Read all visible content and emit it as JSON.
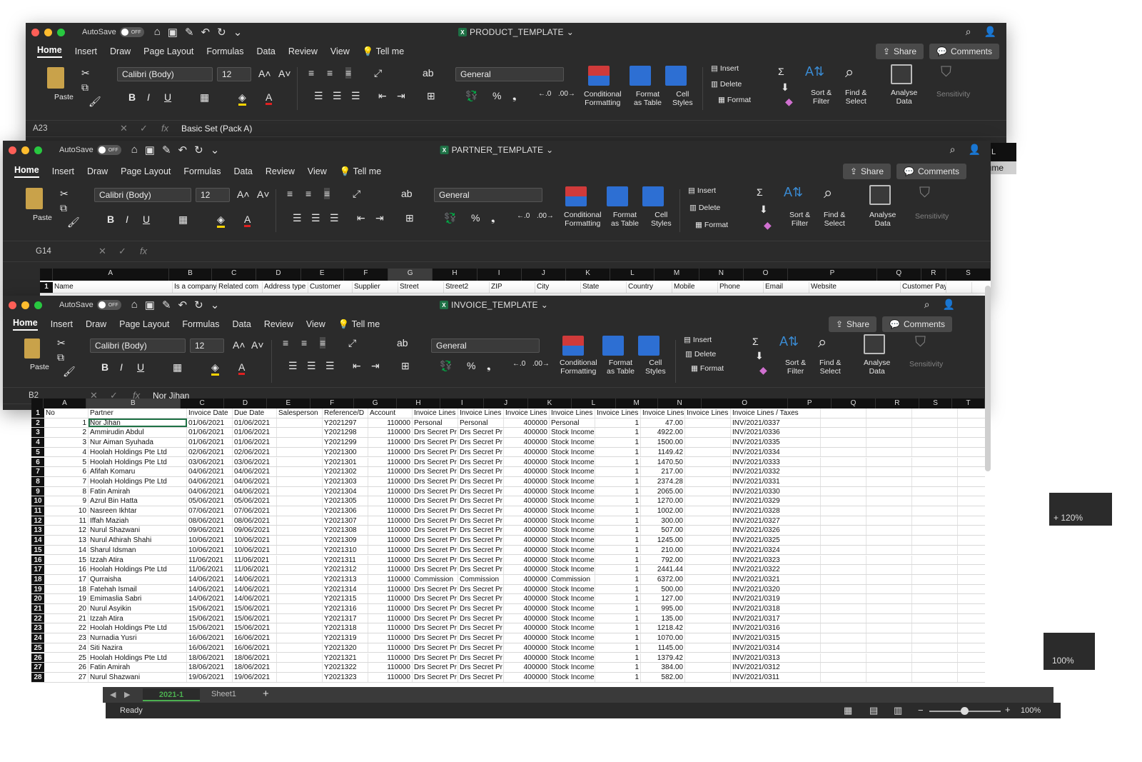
{
  "common": {
    "autosave": "AutoSave",
    "toggle_off": "OFF",
    "tabs": [
      "Home",
      "Insert",
      "Draw",
      "Page Layout",
      "Formulas",
      "Data",
      "Review",
      "View"
    ],
    "tell_me": "Tell me",
    "share": "Share",
    "comments": "Comments",
    "paste": "Paste",
    "font_name": "Calibri (Body)",
    "font_size": "12",
    "number_format": "General",
    "conditional": "Conditional",
    "formatting": "Formatting",
    "format_as": "Format",
    "as_table": "as Table",
    "cell": "Cell",
    "styles": "Styles",
    "insert": "Insert",
    "delete": "Delete",
    "format": "Format",
    "sort_filter_1": "Sort &",
    "sort_filter_2": "Filter",
    "find_select_1": "Find &",
    "find_select_2": "Select",
    "analyse_1": "Analyse",
    "analyse_2": "Data",
    "sensitivity": "Sensitivity"
  },
  "product_window": {
    "title": "PRODUCT_TEMPLATE",
    "name_box": "A23",
    "formula": "Basic Set (Pack A)",
    "peek_col": "L",
    "peek_header": "Volume",
    "zoom": "120%"
  },
  "partner_window": {
    "title": "PARTNER_TEMPLATE",
    "name_box": "G14",
    "formula": "",
    "columns": [
      "A",
      "B",
      "C",
      "D",
      "E",
      "F",
      "G",
      "H",
      "I",
      "J",
      "K",
      "L",
      "M",
      "N",
      "O",
      "P",
      "Q",
      "R",
      "S"
    ],
    "header_row": [
      "Name",
      "Is a company",
      "Related com",
      "Address type",
      "Customer",
      "Supplier",
      "Street",
      "Street2",
      "ZIP",
      "City",
      "State",
      "Country",
      "Mobile",
      "Phone",
      "Email",
      "Website",
      "Customer Payment Terms",
      "",
      ""
    ],
    "zoom": "100%"
  },
  "invoice_window": {
    "title": "INVOICE_TEMPLATE",
    "name_box": "B2",
    "formula": "Nor Jihan",
    "columns": [
      "A",
      "B",
      "C",
      "D",
      "E",
      "F",
      "G",
      "H",
      "I",
      "J",
      "K",
      "L",
      "M",
      "N",
      "O",
      "P",
      "Q",
      "R",
      "S",
      "T"
    ],
    "headers": [
      "No",
      "Partner",
      "Invoice Date",
      "Due Date",
      "Salesperson",
      "Reference/D",
      "Account",
      "Invoice Lines",
      "Invoice Lines",
      "Invoice Lines",
      "Invoice Lines",
      "Invoice Lines",
      "Invoice Lines",
      "Invoice Lines",
      "Invoice Lines / Taxes"
    ],
    "rows": [
      [
        "1",
        "Nor Jihan",
        "01/06/2021",
        "01/06/2021",
        "",
        "Y2021297",
        "110000",
        "Personal",
        "Personal",
        "400000",
        "Personal",
        "1",
        "47.00",
        "",
        "INV/2021/0337"
      ],
      [
        "2",
        "Ammirudin Abdul",
        "01/06/2021",
        "01/06/2021",
        "",
        "Y2021298",
        "110000",
        "Drs Secret Pr",
        "Drs Secret Pr",
        "400000",
        "Stock Income",
        "1",
        "4922.00",
        "",
        "INV/2021/0336"
      ],
      [
        "3",
        "Nur Aiman Syuhada",
        "01/06/2021",
        "01/06/2021",
        "",
        "Y2021299",
        "110000",
        "Drs Secret Pr",
        "Drs Secret Pr",
        "400000",
        "Stock Income",
        "1",
        "1500.00",
        "",
        "INV/2021/0335"
      ],
      [
        "4",
        "Hoolah Holdings Pte Ltd",
        "02/06/2021",
        "02/06/2021",
        "",
        "Y2021300",
        "110000",
        "Drs Secret Pr",
        "Drs Secret Pr",
        "400000",
        "Stock Income",
        "1",
        "1149.42",
        "",
        "INV/2021/0334"
      ],
      [
        "5",
        "Hoolah Holdings Pte Ltd",
        "03/06/2021",
        "03/06/2021",
        "",
        "Y2021301",
        "110000",
        "Drs Secret Pr",
        "Drs Secret Pr",
        "400000",
        "Stock Income",
        "1",
        "1470.50",
        "",
        "INV/2021/0333"
      ],
      [
        "6",
        "Afifah Komaru",
        "04/06/2021",
        "04/06/2021",
        "",
        "Y2021302",
        "110000",
        "Drs Secret Pr",
        "Drs Secret Pr",
        "400000",
        "Stock Income",
        "1",
        "217.00",
        "",
        "INV/2021/0332"
      ],
      [
        "7",
        "Hoolah Holdings Pte Ltd",
        "04/06/2021",
        "04/06/2021",
        "",
        "Y2021303",
        "110000",
        "Drs Secret Pr",
        "Drs Secret Pr",
        "400000",
        "Stock Income",
        "1",
        "2374.28",
        "",
        "INV/2021/0331"
      ],
      [
        "8",
        "Fatin Amirah",
        "04/06/2021",
        "04/06/2021",
        "",
        "Y2021304",
        "110000",
        "Drs Secret Pr",
        "Drs Secret Pr",
        "400000",
        "Stock Income",
        "1",
        "2065.00",
        "",
        "INV/2021/0330"
      ],
      [
        "9",
        "Azrul Bin Hatta",
        "05/06/2021",
        "05/06/2021",
        "",
        "Y2021305",
        "110000",
        "Drs Secret Pr",
        "Drs Secret Pr",
        "400000",
        "Stock Income",
        "1",
        "1270.00",
        "",
        "INV/2021/0329"
      ],
      [
        "10",
        "Nasreen Ikhtar",
        "07/06/2021",
        "07/06/2021",
        "",
        "Y2021306",
        "110000",
        "Drs Secret Pr",
        "Drs Secret Pr",
        "400000",
        "Stock Income",
        "1",
        "1002.00",
        "",
        "INV/2021/0328"
      ],
      [
        "11",
        "Iffah Maziah",
        "08/06/2021",
        "08/06/2021",
        "",
        "Y2021307",
        "110000",
        "Drs Secret Pr",
        "Drs Secret Pr",
        "400000",
        "Stock Income",
        "1",
        "300.00",
        "",
        "INV/2021/0327"
      ],
      [
        "12",
        "Nurul Shazwani",
        "09/06/2021",
        "09/06/2021",
        "",
        "Y2021308",
        "110000",
        "Drs Secret Pr",
        "Drs Secret Pr",
        "400000",
        "Stock Income",
        "1",
        "507.00",
        "",
        "INV/2021/0326"
      ],
      [
        "13",
        "Nurul Athirah Shahi",
        "10/06/2021",
        "10/06/2021",
        "",
        "Y2021309",
        "110000",
        "Drs Secret Pr",
        "Drs Secret Pr",
        "400000",
        "Stock Income",
        "1",
        "1245.00",
        "",
        "INV/2021/0325"
      ],
      [
        "14",
        "Sharul Idsman",
        "10/06/2021",
        "10/06/2021",
        "",
        "Y2021310",
        "110000",
        "Drs Secret Pr",
        "Drs Secret Pr",
        "400000",
        "Stock Income",
        "1",
        "210.00",
        "",
        "INV/2021/0324"
      ],
      [
        "15",
        "Izzah Atira",
        "11/06/2021",
        "11/06/2021",
        "",
        "Y2021311",
        "110000",
        "Drs Secret Pr",
        "Drs Secret Pr",
        "400000",
        "Stock Income",
        "1",
        "792.00",
        "",
        "INV/2021/0323"
      ],
      [
        "16",
        "Hoolah Holdings Pte Ltd",
        "11/06/2021",
        "11/06/2021",
        "",
        "Y2021312",
        "110000",
        "Drs Secret Pr",
        "Drs Secret Pr",
        "400000",
        "Stock Income",
        "1",
        "2441.44",
        "",
        "INV/2021/0322"
      ],
      [
        "17",
        "Qurraisha",
        "14/06/2021",
        "14/06/2021",
        "",
        "Y2021313",
        "110000",
        "Commission",
        "Commission",
        "400000",
        "Commission",
        "1",
        "6372.00",
        "",
        "INV/2021/0321"
      ],
      [
        "18",
        "Fatehah Ismail",
        "14/06/2021",
        "14/06/2021",
        "",
        "Y2021314",
        "110000",
        "Drs Secret Pr",
        "Drs Secret Pr",
        "400000",
        "Stock Income",
        "1",
        "500.00",
        "",
        "INV/2021/0320"
      ],
      [
        "19",
        "Emimaslia Sabri",
        "14/06/2021",
        "14/06/2021",
        "",
        "Y2021315",
        "110000",
        "Drs Secret Pr",
        "Drs Secret Pr",
        "400000",
        "Stock Income",
        "1",
        "127.00",
        "",
        "INV/2021/0319"
      ],
      [
        "20",
        "Nurul Asyikin",
        "15/06/2021",
        "15/06/2021",
        "",
        "Y2021316",
        "110000",
        "Drs Secret Pr",
        "Drs Secret Pr",
        "400000",
        "Stock Income",
        "1",
        "995.00",
        "",
        "INV/2021/0318"
      ],
      [
        "21",
        "Izzah Atira",
        "15/06/2021",
        "15/06/2021",
        "",
        "Y2021317",
        "110000",
        "Drs Secret Pr",
        "Drs Secret Pr",
        "400000",
        "Stock Income",
        "1",
        "135.00",
        "",
        "INV/2021/0317"
      ],
      [
        "22",
        "Hoolah Holdings Pte Ltd",
        "15/06/2021",
        "15/06/2021",
        "",
        "Y2021318",
        "110000",
        "Drs Secret Pr",
        "Drs Secret Pr",
        "400000",
        "Stock Income",
        "1",
        "1218.42",
        "",
        "INV/2021/0316"
      ],
      [
        "23",
        "Nurnadia Yusri",
        "16/06/2021",
        "16/06/2021",
        "",
        "Y2021319",
        "110000",
        "Drs Secret Pr",
        "Drs Secret Pr",
        "400000",
        "Stock Income",
        "1",
        "1070.00",
        "",
        "INV/2021/0315"
      ],
      [
        "24",
        "Siti Nazira",
        "16/06/2021",
        "16/06/2021",
        "",
        "Y2021320",
        "110000",
        "Drs Secret Pr",
        "Drs Secret Pr",
        "400000",
        "Stock Income",
        "1",
        "1145.00",
        "",
        "INV/2021/0314"
      ],
      [
        "25",
        "Hoolah Holdings Pte Ltd",
        "18/06/2021",
        "18/06/2021",
        "",
        "Y2021321",
        "110000",
        "Drs Secret Pr",
        "Drs Secret Pr",
        "400000",
        "Stock Income",
        "1",
        "1379.42",
        "",
        "INV/2021/0313"
      ],
      [
        "26",
        "Fatin Amirah",
        "18/06/2021",
        "18/06/2021",
        "",
        "Y2021322",
        "110000",
        "Drs Secret Pr",
        "Drs Secret Pr",
        "400000",
        "Stock Income",
        "1",
        "384.00",
        "",
        "INV/2021/0312"
      ],
      [
        "27",
        "Nurul Shazwani",
        "19/06/2021",
        "19/06/2021",
        "",
        "Y2021323",
        "110000",
        "Drs Secret Pr",
        "Drs Secret Pr",
        "400000",
        "Stock Income",
        "1",
        "582.00",
        "",
        "INV/2021/0311"
      ]
    ],
    "sheet_tabs": [
      "2021-1",
      "Sheet1"
    ],
    "add_sheet": "+",
    "status": "Ready",
    "zoom": "100%",
    "zoom_minus": "−",
    "zoom_plus": "+"
  },
  "colors": {
    "chrome": "#2b2b2b",
    "excel_green": "#1e7145",
    "grid_line": "#d9d9d9"
  }
}
